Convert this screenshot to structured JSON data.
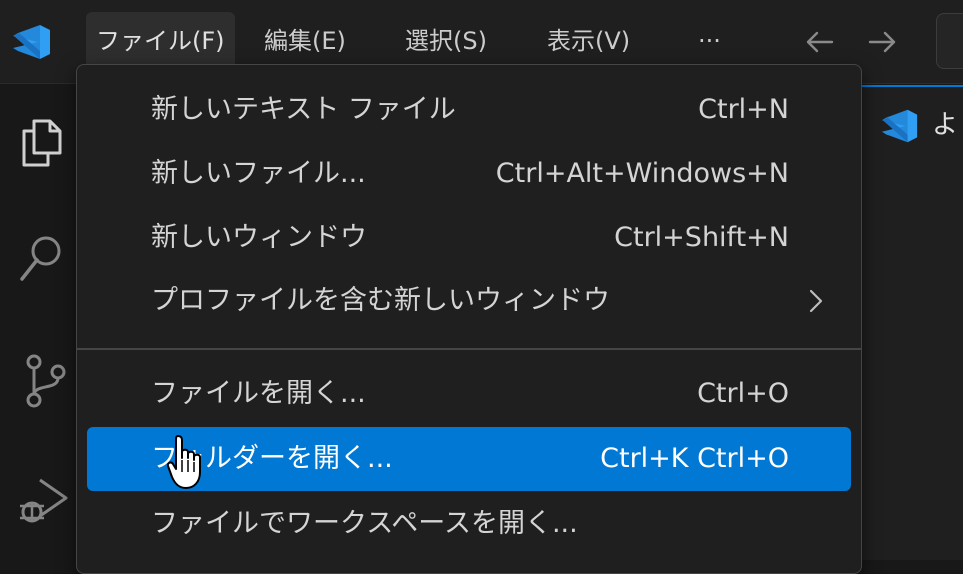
{
  "menubar": {
    "items": [
      {
        "label": "ファイル(F)"
      },
      {
        "label": "編集(E)"
      },
      {
        "label": "選択(S)"
      },
      {
        "label": "表示(V)"
      },
      {
        "label": "···"
      }
    ]
  },
  "file_menu": {
    "items": [
      {
        "label": "新しいテキスト ファイル",
        "shortcut": "Ctrl+N"
      },
      {
        "label": "新しいファイル...",
        "shortcut": "Ctrl+Alt+Windows+N"
      },
      {
        "label": "新しいウィンドウ",
        "shortcut": "Ctrl+Shift+N"
      },
      {
        "label": "プロファイルを含む新しいウィンドウ",
        "shortcut": ""
      },
      {
        "label": "ファイルを開く...",
        "shortcut": "Ctrl+O"
      },
      {
        "label": "フォルダーを開く...",
        "shortcut": "Ctrl+K Ctrl+O"
      },
      {
        "label": "ファイルでワークスペースを開く...",
        "shortcut": ""
      }
    ]
  },
  "editor": {
    "tab_title_visible": "よ"
  },
  "colors": {
    "accent": "#0078d4",
    "vscode_logo": "#2f9ef3",
    "menu_background": "#1f1f1f"
  },
  "icons": {
    "app_logo": "vscode-logo-icon",
    "activity_bar": [
      "explorer-icon",
      "search-icon",
      "source-control-icon",
      "run-debug-icon"
    ],
    "back": "arrow-left-icon",
    "forward": "arrow-right-icon",
    "submenu": "chevron-right-icon",
    "cursor": "hand-pointer-icon"
  }
}
